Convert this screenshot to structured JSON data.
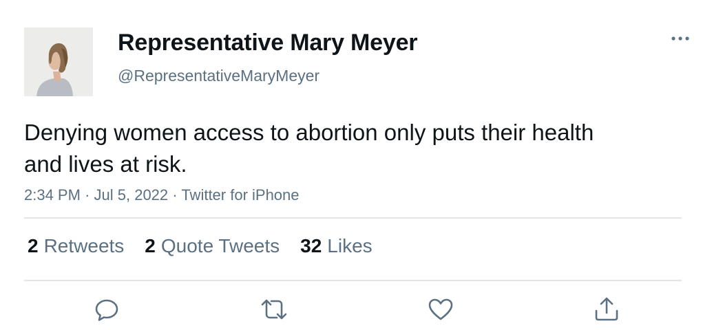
{
  "tweet": {
    "author": {
      "display_name": "Representative Mary Meyer",
      "handle": "@RepresentativeMaryMeyer"
    },
    "text": "Denying women access to abortion only puts their health and lives at risk.",
    "meta": {
      "time": "2:34 PM",
      "separator": "·",
      "date": "Jul 5, 2022",
      "source": "Twitter for iPhone"
    },
    "stats": {
      "retweets": {
        "count": "2",
        "label": "Retweets"
      },
      "quote_tweets": {
        "count": "2",
        "label": "Quote Tweets"
      },
      "likes": {
        "count": "32",
        "label": "Likes"
      }
    },
    "actions": [
      "reply-icon",
      "retweet-icon",
      "like-icon",
      "share-icon"
    ],
    "colors": {
      "primary_text": "#0f1419",
      "secondary_text": "#5b7083",
      "divider": "#e1e5e8"
    }
  }
}
